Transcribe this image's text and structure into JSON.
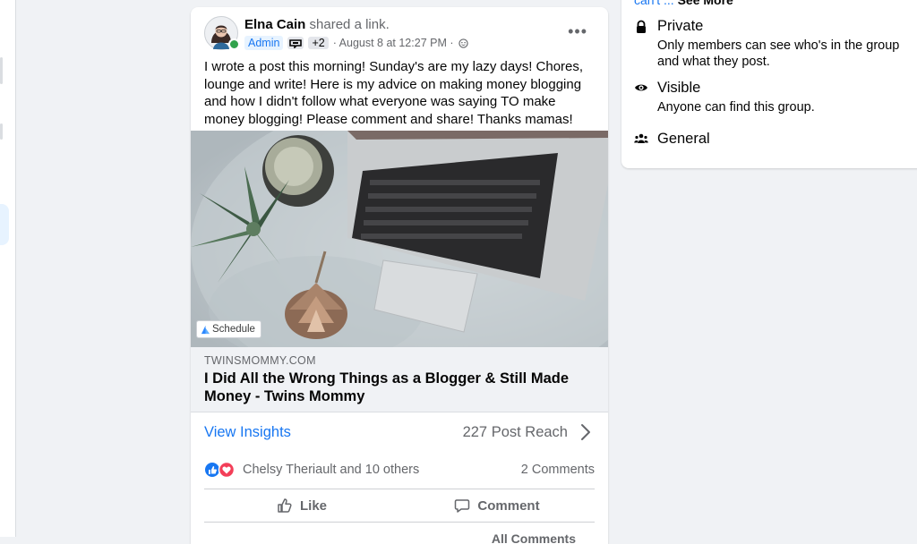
{
  "post": {
    "author": "Elna Cain",
    "action_text": "shared a link.",
    "role_badge": "Admin",
    "extra_badges": "+2",
    "timestamp": "· August 8 at 12:27 PM ·",
    "more_label": "•••",
    "body": "I wrote a post this morning! Sunday's are my lazy days! Chores, lounge and write! Here is my advice on making money blogging and how I didn't follow what everyone was saying TO make money blogging! Please comment and share! Thanks mamas!",
    "image_tag": "Schedule",
    "link": {
      "domain": "TWINSMOMMY.COM",
      "title": "I Did All the Wrong Things as a Blogger & Still Made Money - Twins Mommy"
    },
    "insights": {
      "label": "View Insights",
      "reach": "227 Post Reach"
    },
    "reactions": {
      "names": "Chelsy Theriault and 10 others",
      "comments": "2 Comments",
      "types": [
        "like",
        "love"
      ]
    },
    "actions": {
      "like": "Like",
      "comment": "Comment"
    },
    "all_comments": "All Comments"
  },
  "about": {
    "see_more_prefix": "can't ...",
    "see_more": "See More",
    "items": [
      {
        "icon": "lock-icon",
        "title": "Private",
        "description": "Only members can see who's in the group and what they post."
      },
      {
        "icon": "eye-icon",
        "title": "Visible",
        "description": "Anyone can find this group."
      },
      {
        "icon": "people-icon",
        "title": "General",
        "description": ""
      }
    ]
  },
  "colors": {
    "accent": "#1877f2",
    "background": "#f0f2f5",
    "secondary_text": "#65676b",
    "online": "#31a24c",
    "love": "#f33e58"
  }
}
